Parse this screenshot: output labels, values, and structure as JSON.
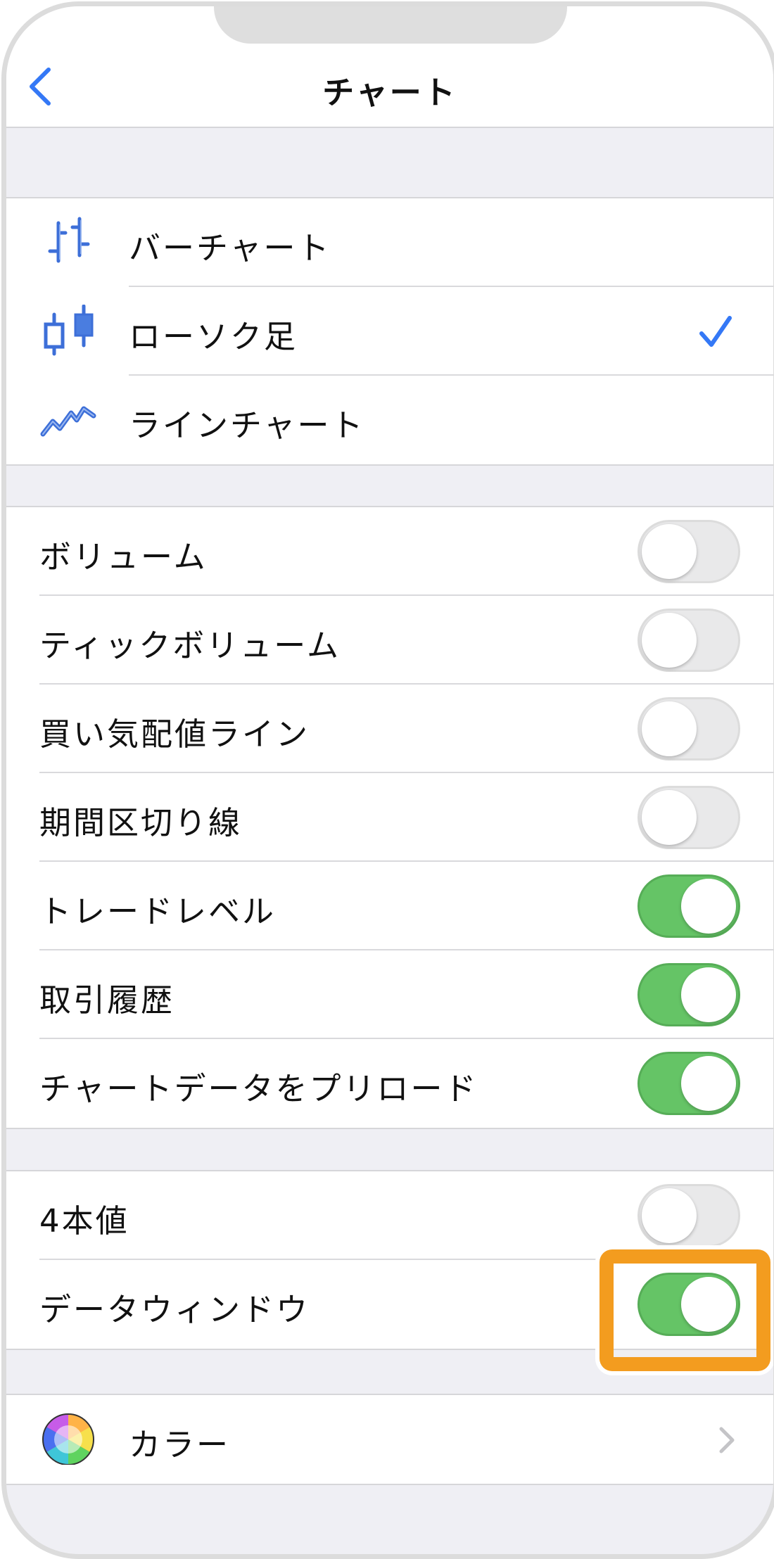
{
  "nav": {
    "title": "チャート",
    "back_icon": "chevron-left-icon"
  },
  "chart_types": [
    {
      "label": "バーチャート",
      "icon": "bar-chart-icon",
      "selected": false
    },
    {
      "label": "ローソク足",
      "icon": "candlestick-icon",
      "selected": true
    },
    {
      "label": "ラインチャート",
      "icon": "line-chart-icon",
      "selected": false
    }
  ],
  "display_options": [
    {
      "label": "ボリューム",
      "on": false
    },
    {
      "label": "ティックボリューム",
      "on": false
    },
    {
      "label": "買い気配値ライン",
      "on": false
    },
    {
      "label": "期間区切り線",
      "on": false
    },
    {
      "label": "トレードレベル",
      "on": true
    },
    {
      "label": "取引履歴",
      "on": true
    },
    {
      "label": "チャートデータをプリロード",
      "on": true
    }
  ],
  "extra_options": [
    {
      "label": "4本値",
      "on": false
    },
    {
      "label": "データウィンドウ",
      "on": true,
      "highlighted": true
    }
  ],
  "color_row": {
    "label": "カラー",
    "icon": "color-wheel-icon"
  },
  "colors": {
    "accent": "#3478f6",
    "toggle_on": "#65c466",
    "toggle_off": "#e9e9ea",
    "highlight": "#f39c1f",
    "grouped_background": "#efeff4"
  }
}
